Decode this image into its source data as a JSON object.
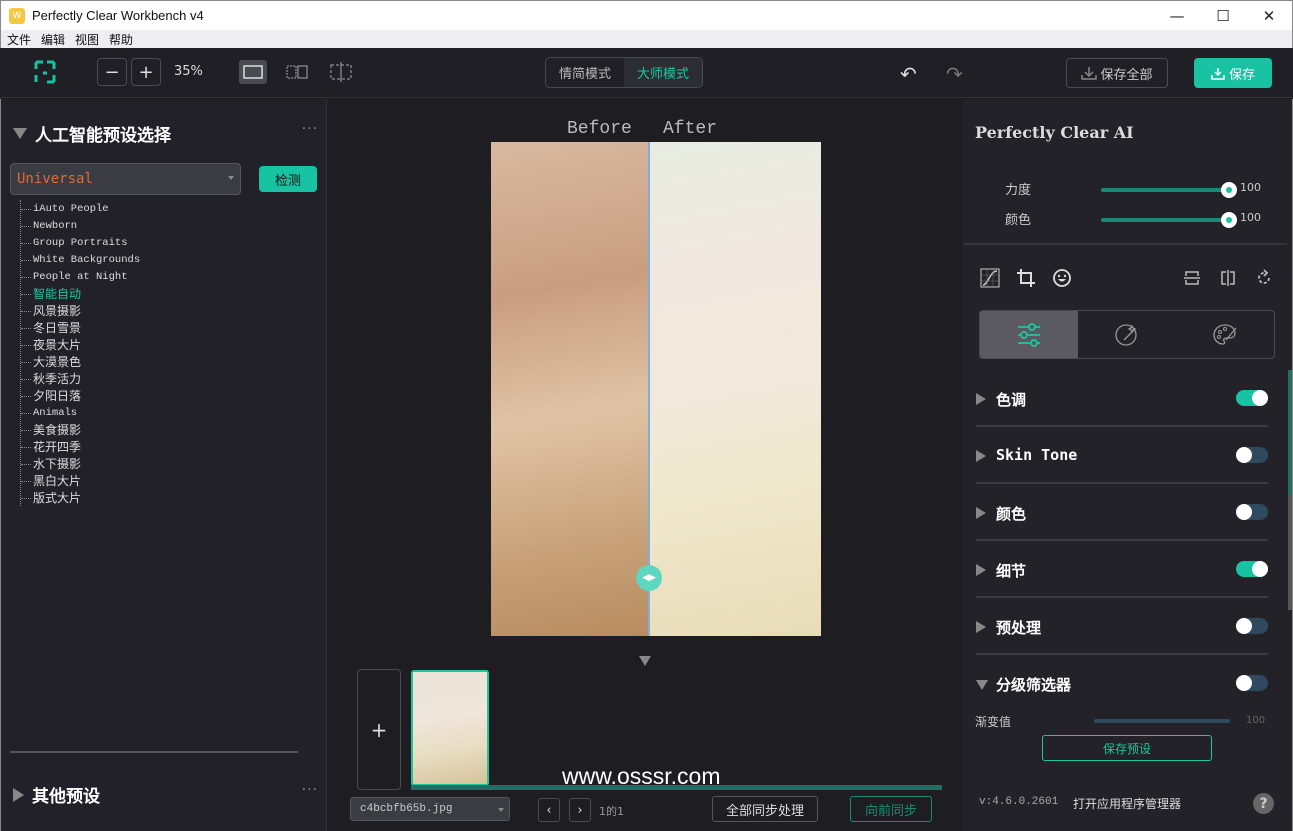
{
  "window": {
    "title": "Perfectly Clear Workbench v4",
    "controls": {
      "minimize": "—",
      "maximize": "☐",
      "close": "✕"
    }
  },
  "menu": [
    "文件",
    "编辑",
    "视图",
    "帮助"
  ],
  "toolbar": {
    "zoom_out": "−",
    "zoom_in": "+",
    "zoom_level": "35%",
    "modes": [
      {
        "label": "情简模式",
        "active": false
      },
      {
        "label": "大师模式",
        "active": true
      }
    ],
    "undo": "↶",
    "redo": "↷",
    "save_all_label": "保存全部",
    "save_label": "保存"
  },
  "left_panel": {
    "ai_section_title": "人工智能预设选择",
    "more": "···",
    "preset_selected": "Universal",
    "detect_label": "检测",
    "presets": [
      {
        "label": "iAuto People",
        "latin": true,
        "active": false
      },
      {
        "label": "Newborn",
        "latin": true,
        "active": false
      },
      {
        "label": "Group Portraits",
        "latin": true,
        "active": false
      },
      {
        "label": "White Backgrounds",
        "latin": true,
        "active": false
      },
      {
        "label": "People at Night",
        "latin": true,
        "active": false
      },
      {
        "label": "智能自动",
        "latin": false,
        "active": true
      },
      {
        "label": "风景摄影",
        "latin": false,
        "active": false
      },
      {
        "label": "冬日雪景",
        "latin": false,
        "active": false
      },
      {
        "label": "夜景大片",
        "latin": false,
        "active": false
      },
      {
        "label": "大漠景色",
        "latin": false,
        "active": false
      },
      {
        "label": "秋季活力",
        "latin": false,
        "active": false
      },
      {
        "label": "夕阳日落",
        "latin": false,
        "active": false
      },
      {
        "label": "Animals",
        "latin": true,
        "active": false
      },
      {
        "label": "美食摄影",
        "latin": false,
        "active": false
      },
      {
        "label": "花开四季",
        "latin": false,
        "active": false
      },
      {
        "label": "水下摄影",
        "latin": false,
        "active": false
      },
      {
        "label": "黑白大片",
        "latin": false,
        "active": false
      },
      {
        "label": "版式大片",
        "latin": false,
        "active": false
      }
    ],
    "other_section_title": "其他预设"
  },
  "center": {
    "before_label": "Before",
    "after_label": "After",
    "add_label": "+",
    "watermark": "www.osssr.com",
    "file_name": "c4bcbfb65b.jpg",
    "prev": "‹",
    "next": "›",
    "page_count": "1的1",
    "sync_all_label": "全部同步处理",
    "sync_forward_label": "向前同步"
  },
  "right_panel": {
    "title": "Perfectly Clear AI",
    "sliders": [
      {
        "label": "力度",
        "value": 100,
        "max": 100
      },
      {
        "label": "颜色",
        "value": 100,
        "max": 100
      }
    ],
    "sections": [
      {
        "label": "色调",
        "enabled": true,
        "expanded": false
      },
      {
        "label": "Skin Tone",
        "enabled": false,
        "expanded": false
      },
      {
        "label": "颜色",
        "enabled": false,
        "expanded": false
      },
      {
        "label": "细节",
        "enabled": true,
        "expanded": false
      },
      {
        "label": "预处理",
        "enabled": false,
        "expanded": false
      },
      {
        "label": "分级筛选器",
        "enabled": false,
        "expanded": true
      }
    ],
    "gradient_label": "渐变值",
    "gradient_value": "100",
    "save_preset_label": "保存预设",
    "version": "v:4.6.0.2601",
    "app_manager_label": "打开应用程序管理器",
    "help": "?"
  },
  "colors": {
    "accent": "#17c3a2",
    "toggle_off": "#2f4a5e",
    "preset_text": "#e06a3a"
  }
}
